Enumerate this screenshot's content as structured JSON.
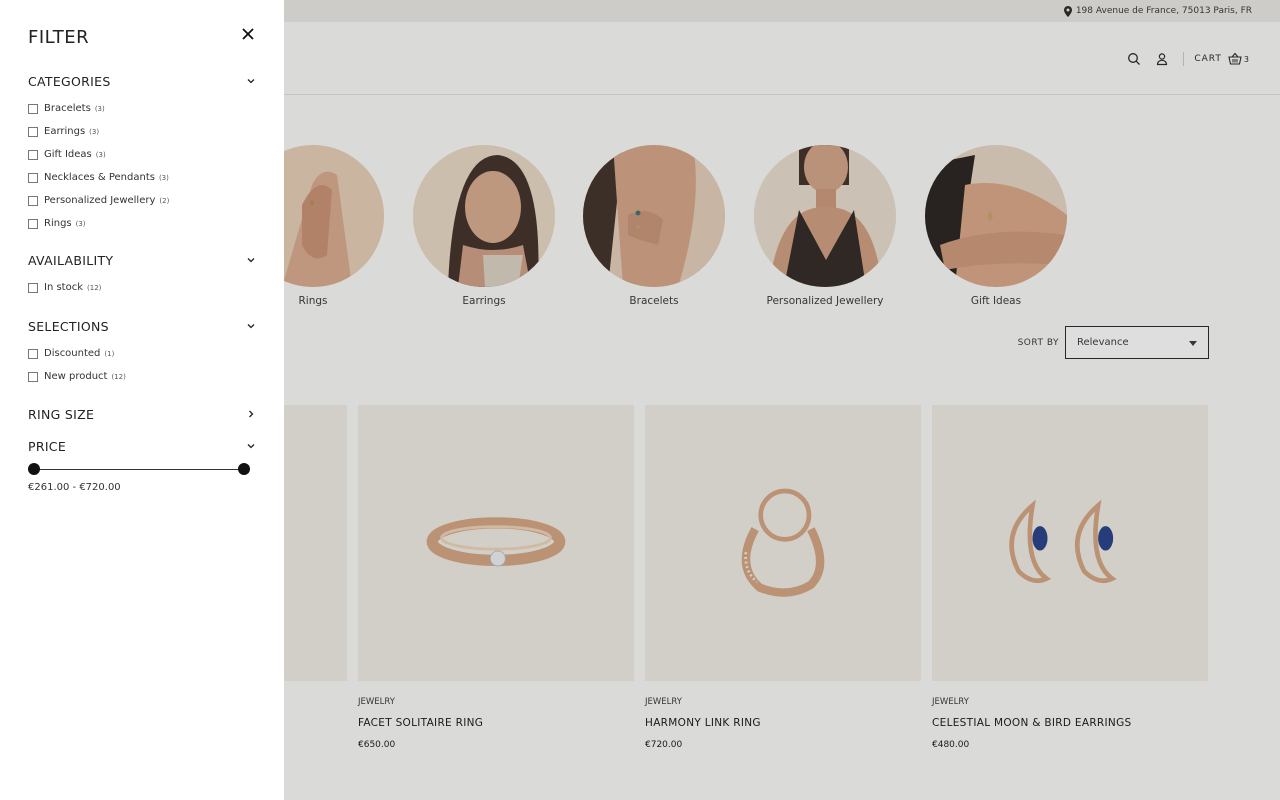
{
  "topbar": {
    "address": "198 Avenue de France, 75013 Paris, FR"
  },
  "header": {
    "cart_label": "CART",
    "cart_count": "3"
  },
  "collections": [
    {
      "label": "Rings"
    },
    {
      "label": "Earrings"
    },
    {
      "label": "Bracelets"
    },
    {
      "label": "Personalized Jewellery"
    },
    {
      "label": "Gift Ideas"
    }
  ],
  "sort": {
    "label": "SORT BY",
    "value": "Relevance"
  },
  "products": [
    {
      "category": "JEWELRY",
      "name": "FACET SOLITAIRE RING",
      "price": "€650.00"
    },
    {
      "category": "JEWELRY",
      "name": "HARMONY LINK RING",
      "price": "€720.00"
    },
    {
      "category": "JEWELRY",
      "name": "CELESTIAL MOON & BIRD EARRINGS",
      "price": "€480.00"
    }
  ],
  "filter": {
    "title": "FILTER",
    "categories": {
      "title": "CATEGORIES",
      "options": [
        {
          "label": "Bracelets",
          "count": "(3)"
        },
        {
          "label": "Earrings",
          "count": "(3)"
        },
        {
          "label": "Gift Ideas",
          "count": "(3)"
        },
        {
          "label": "Necklaces & Pendants",
          "count": "(3)"
        },
        {
          "label": "Personalized Jewellery",
          "count": "(2)"
        },
        {
          "label": "Rings",
          "count": "(3)"
        }
      ]
    },
    "availability": {
      "title": "AVAILABILITY",
      "options": [
        {
          "label": "In stock",
          "count": "(12)"
        }
      ]
    },
    "selections": {
      "title": "SELECTIONS",
      "options": [
        {
          "label": "Discounted",
          "count": "(1)"
        },
        {
          "label": "New product",
          "count": "(12)"
        }
      ]
    },
    "ring_size": {
      "title": "RING SIZE"
    },
    "price": {
      "title": "PRICE",
      "range_text": "€261.00 - €720.00",
      "min_fraction": 0,
      "max_fraction": 1
    }
  },
  "colors": {
    "accent": "#111111",
    "overlay": "#464646",
    "product_bg": "#f1ede6",
    "gold": "#d9a77f"
  }
}
